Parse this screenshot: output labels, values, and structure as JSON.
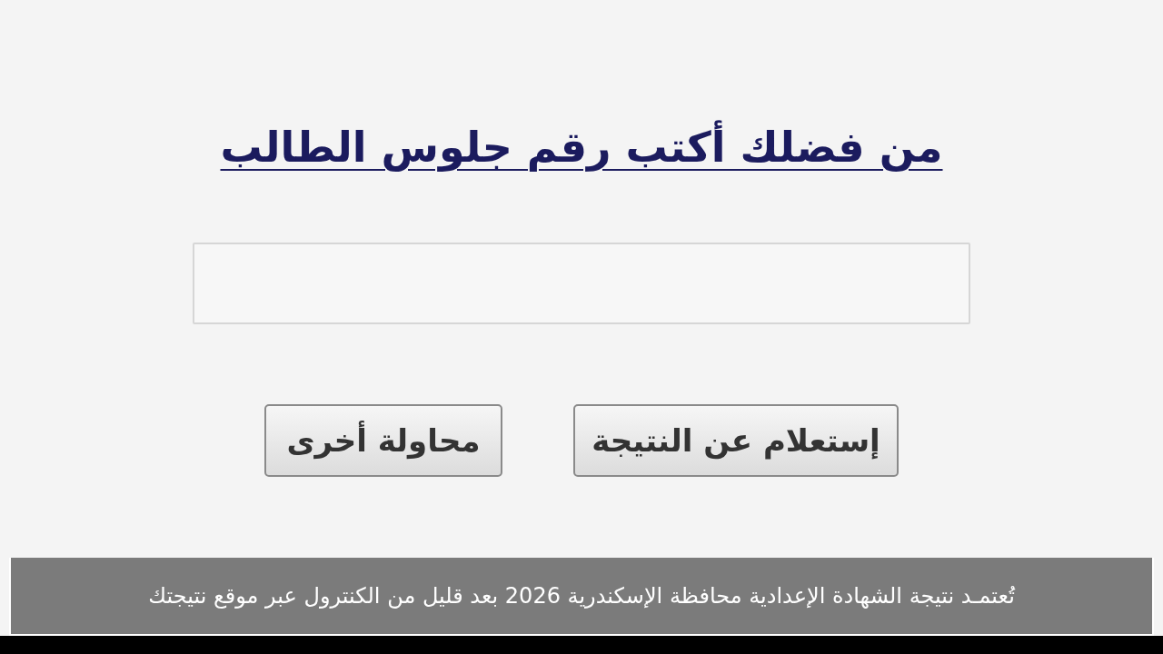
{
  "heading": "من فضلك أكتب رقم جلوس الطالب",
  "buttons": [
    "إستعلام عن النتيجة",
    "محاولة أخرى"
  ],
  "caption": "تُعتمـد نتيجة الشهادة الإعدادية محافظة الإسكندرية 2026 بعد قليل من الكنترول عبر موقع نتيجتك"
}
